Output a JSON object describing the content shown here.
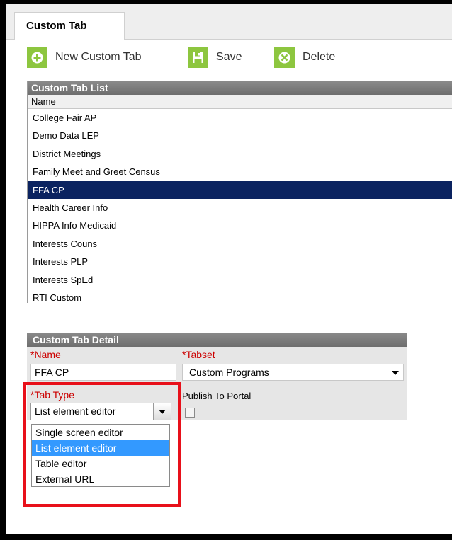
{
  "tab": {
    "label": "Custom Tab"
  },
  "toolbar": {
    "new_label": "New Custom Tab",
    "save_label": "Save",
    "delete_label": "Delete"
  },
  "list": {
    "title": "Custom Tab List",
    "column": "Name",
    "items": [
      "College Fair AP",
      "Demo Data LEP",
      "District Meetings",
      "Family Meet and Greet Census",
      "FFA CP",
      "Health Career Info",
      "HIPPA Info Medicaid",
      "Interests Couns",
      "Interests PLP",
      "Interests SpEd",
      "RTI Custom"
    ],
    "selected_index": 4
  },
  "detail": {
    "title": "Custom Tab Detail",
    "name_label": "*Name",
    "name_value": "FFA CP",
    "tabset_label": "*Tabset",
    "tabset_value": "Custom Programs",
    "tabtype_label": "*Tab Type",
    "tabtype_value": "List element editor",
    "publish_label": "Publish To Portal",
    "publish_checked": false
  },
  "dropdown": {
    "options": [
      "Single screen editor",
      "List element editor",
      "Table editor",
      "External URL"
    ],
    "highlighted_index": 1
  },
  "colors": {
    "toolbar_icon": "#8dc63f",
    "selected_row": "#0b2360",
    "highlight_option": "#3399ff",
    "required_label": "#cc0000",
    "annotation_box": "#e8101a"
  }
}
